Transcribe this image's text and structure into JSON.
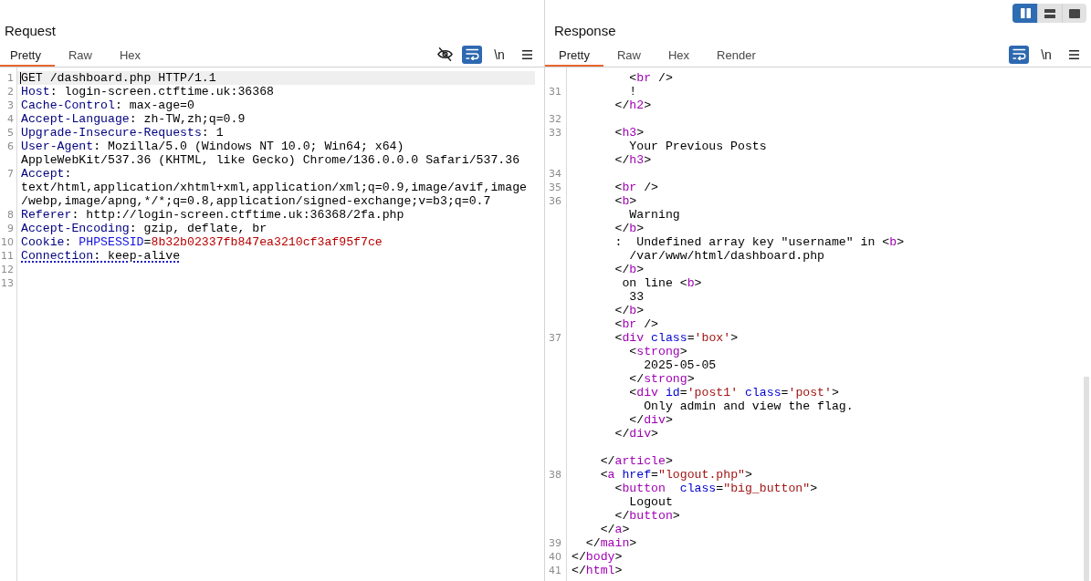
{
  "layout_toggle": [
    {
      "kind": "columns",
      "selected": true
    },
    {
      "kind": "rows",
      "selected": false
    },
    {
      "kind": "single",
      "selected": false
    }
  ],
  "request": {
    "title": "Request",
    "tabs": [
      {
        "label": "Pretty",
        "selected": true
      },
      {
        "label": "Raw",
        "selected": false
      },
      {
        "label": "Hex",
        "selected": false
      }
    ],
    "toolbar": [
      {
        "kind": "hide",
        "on": false
      },
      {
        "kind": "wrap",
        "on": true
      },
      {
        "kind": "newlines",
        "label": "\\n",
        "on": false
      },
      {
        "kind": "menu",
        "on": false
      }
    ],
    "lines": [
      {
        "number": "1",
        "current": true,
        "underlined": false,
        "rows": [
          {
            "kind": "code",
            "segments": [
              {
                "kind": "plain",
                "text": "GET /dashboard.php HTTP/1.1"
              }
            ]
          }
        ]
      },
      {
        "number": "2",
        "current": false,
        "underlined": false,
        "rows": [
          {
            "kind": "code",
            "segments": [
              {
                "kind": "header",
                "text": "Host"
              },
              {
                "kind": "plain",
                "text": ": login-screen.ctftime.uk:36368"
              }
            ]
          }
        ]
      },
      {
        "number": "3",
        "current": false,
        "underlined": false,
        "rows": [
          {
            "kind": "code",
            "segments": [
              {
                "kind": "header",
                "text": "Cache-Control"
              },
              {
                "kind": "plain",
                "text": ": max-age=0"
              }
            ]
          }
        ]
      },
      {
        "number": "4",
        "current": false,
        "underlined": false,
        "rows": [
          {
            "kind": "code",
            "segments": [
              {
                "kind": "header",
                "text": "Accept-Language"
              },
              {
                "kind": "plain",
                "text": ": zh-TW,zh;q=0.9"
              }
            ]
          }
        ]
      },
      {
        "number": "5",
        "current": false,
        "underlined": false,
        "rows": [
          {
            "kind": "code",
            "segments": [
              {
                "kind": "header",
                "text": "Upgrade-Insecure-Requests"
              },
              {
                "kind": "plain",
                "text": ": 1"
              }
            ]
          }
        ]
      },
      {
        "number": "6",
        "current": false,
        "underlined": false,
        "rows": [
          {
            "kind": "code",
            "segments": [
              {
                "kind": "header",
                "text": "User-Agent"
              },
              {
                "kind": "plain",
                "text": ": Mozilla/5.0 (Windows NT 10.0; Win64; x64)"
              }
            ]
          },
          {
            "kind": "code",
            "segments": [
              {
                "kind": "plain",
                "text": "AppleWebKit/537.36 (KHTML, like Gecko) Chrome/136.0.0.0 Safari/537.36"
              }
            ]
          }
        ]
      },
      {
        "number": "7",
        "current": false,
        "underlined": false,
        "rows": [
          {
            "kind": "code",
            "segments": [
              {
                "kind": "header",
                "text": "Accept"
              },
              {
                "kind": "plain",
                "text": ":"
              }
            ]
          },
          {
            "kind": "code",
            "segments": [
              {
                "kind": "plain",
                "text": "text/html,application/xhtml+xml,application/xml;q=0.9,image/avif,image"
              }
            ]
          },
          {
            "kind": "code",
            "segments": [
              {
                "kind": "plain",
                "text": "/webp,image/apng,*/*;q=0.8,application/signed-exchange;v=b3;q=0.7"
              }
            ]
          }
        ]
      },
      {
        "number": "8",
        "current": false,
        "underlined": false,
        "rows": [
          {
            "kind": "code",
            "segments": [
              {
                "kind": "header",
                "text": "Referer"
              },
              {
                "kind": "plain",
                "text": ": http://login-screen.ctftime.uk:36368/2fa.php"
              }
            ]
          }
        ]
      },
      {
        "number": "9",
        "current": false,
        "underlined": false,
        "rows": [
          {
            "kind": "code",
            "segments": [
              {
                "kind": "header",
                "text": "Accept-Encoding"
              },
              {
                "kind": "plain",
                "text": ": gzip, deflate, br"
              }
            ]
          }
        ]
      },
      {
        "number": "10",
        "current": false,
        "underlined": false,
        "rows": [
          {
            "kind": "code",
            "segments": [
              {
                "kind": "header",
                "text": "Cookie"
              },
              {
                "kind": "plain",
                "text": ": "
              },
              {
                "kind": "cookie_name",
                "text": "PHPSESSID"
              },
              {
                "kind": "plain",
                "text": "="
              },
              {
                "kind": "cookie_value",
                "text": "8b32b02337fb847ea3210cf3af95f7ce"
              }
            ]
          }
        ]
      },
      {
        "number": "11",
        "current": false,
        "underlined": true,
        "rows": [
          {
            "kind": "code",
            "segments": [
              {
                "kind": "header",
                "text": "Connection"
              },
              {
                "kind": "plain",
                "text": ": keep-alive"
              }
            ]
          }
        ]
      },
      {
        "number": "12",
        "current": false,
        "rows": [
          {
            "kind": "blank"
          }
        ]
      },
      {
        "number": "13",
        "current": false,
        "rows": [
          {
            "kind": "blank"
          }
        ]
      }
    ]
  },
  "response": {
    "title": "Response",
    "tabs": [
      {
        "label": "Pretty",
        "selected": true
      },
      {
        "label": "Raw",
        "selected": false
      },
      {
        "label": "Hex",
        "selected": false
      },
      {
        "label": "Render",
        "selected": false
      }
    ],
    "toolbar": [
      {
        "kind": "wrap",
        "on": true
      },
      {
        "kind": "newlines",
        "label": "\\n",
        "on": false
      },
      {
        "kind": "menu",
        "on": false
      }
    ],
    "lines": [
      {
        "rows": [
          {
            "kind": "code",
            "segments": [
              {
                "kind": "plain",
                "text": "        <"
              },
              {
                "kind": "tag",
                "text": "br"
              },
              {
                "kind": "plain",
                "text": " />"
              }
            ]
          }
        ]
      },
      {
        "number": "31",
        "rows": [
          {
            "kind": "code",
            "segments": [
              {
                "kind": "plain",
                "text": "        !"
              }
            ]
          },
          {
            "kind": "code",
            "segments": [
              {
                "kind": "plain",
                "text": "      </"
              },
              {
                "kind": "tag",
                "text": "h2"
              },
              {
                "kind": "plain",
                "text": ">"
              }
            ]
          }
        ]
      },
      {
        "number": "32",
        "rows": [
          {
            "kind": "blank"
          }
        ]
      },
      {
        "number": "33",
        "rows": [
          {
            "kind": "code",
            "segments": [
              {
                "kind": "plain",
                "text": "      <"
              },
              {
                "kind": "tag",
                "text": "h3"
              },
              {
                "kind": "plain",
                "text": ">"
              }
            ]
          },
          {
            "kind": "code",
            "segments": [
              {
                "kind": "plain",
                "text": "        Your Previous Posts"
              }
            ]
          },
          {
            "kind": "code",
            "segments": [
              {
                "kind": "plain",
                "text": "      </"
              },
              {
                "kind": "tag",
                "text": "h3"
              },
              {
                "kind": "plain",
                "text": ">"
              }
            ]
          }
        ]
      },
      {
        "number": "34",
        "rows": [
          {
            "kind": "blank"
          }
        ]
      },
      {
        "number": "35",
        "rows": [
          {
            "kind": "code",
            "segments": [
              {
                "kind": "plain",
                "text": "      <"
              },
              {
                "kind": "tag",
                "text": "br"
              },
              {
                "kind": "plain",
                "text": " />"
              }
            ]
          }
        ]
      },
      {
        "number": "36",
        "rows": [
          {
            "kind": "code",
            "segments": [
              {
                "kind": "plain",
                "text": "      <"
              },
              {
                "kind": "tag",
                "text": "b"
              },
              {
                "kind": "plain",
                "text": ">"
              }
            ]
          },
          {
            "kind": "code",
            "segments": [
              {
                "kind": "plain",
                "text": "        Warning"
              }
            ]
          },
          {
            "kind": "code",
            "segments": [
              {
                "kind": "plain",
                "text": "      </"
              },
              {
                "kind": "tag",
                "text": "b"
              },
              {
                "kind": "plain",
                "text": ">"
              }
            ]
          },
          {
            "kind": "code",
            "segments": [
              {
                "kind": "plain",
                "text": "      :  Undefined array key \"username\" in <"
              },
              {
                "kind": "tag",
                "text": "b"
              },
              {
                "kind": "plain",
                "text": ">"
              }
            ]
          },
          {
            "kind": "code",
            "segments": [
              {
                "kind": "plain",
                "text": "        /var/www/html/dashboard.php"
              }
            ]
          },
          {
            "kind": "code",
            "segments": [
              {
                "kind": "plain",
                "text": "      </"
              },
              {
                "kind": "tag",
                "text": "b"
              },
              {
                "kind": "plain",
                "text": ">"
              }
            ]
          },
          {
            "kind": "code",
            "segments": [
              {
                "kind": "plain",
                "text": "       on line <"
              },
              {
                "kind": "tag",
                "text": "b"
              },
              {
                "kind": "plain",
                "text": ">"
              }
            ]
          },
          {
            "kind": "code",
            "segments": [
              {
                "kind": "plain",
                "text": "        33"
              }
            ]
          },
          {
            "kind": "code",
            "segments": [
              {
                "kind": "plain",
                "text": "      </"
              },
              {
                "kind": "tag",
                "text": "b"
              },
              {
                "kind": "plain",
                "text": ">"
              }
            ]
          },
          {
            "kind": "code",
            "segments": [
              {
                "kind": "plain",
                "text": "      <"
              },
              {
                "kind": "tag",
                "text": "br"
              },
              {
                "kind": "plain",
                "text": " />"
              }
            ]
          }
        ]
      },
      {
        "number": "37",
        "rows": [
          {
            "kind": "code",
            "segments": [
              {
                "kind": "plain",
                "text": "      <"
              },
              {
                "kind": "tag",
                "text": "div"
              },
              {
                "kind": "attr",
                "text": " class"
              },
              {
                "kind": "plain",
                "text": "="
              },
              {
                "kind": "value",
                "text": "'box'"
              },
              {
                "kind": "plain",
                "text": ">"
              }
            ]
          },
          {
            "kind": "code",
            "segments": [
              {
                "kind": "plain",
                "text": "        <"
              },
              {
                "kind": "tag",
                "text": "strong"
              },
              {
                "kind": "plain",
                "text": ">"
              }
            ]
          },
          {
            "kind": "code",
            "segments": [
              {
                "kind": "plain",
                "text": "          2025-05-05"
              }
            ]
          },
          {
            "kind": "code",
            "segments": [
              {
                "kind": "plain",
                "text": "        </"
              },
              {
                "kind": "tag",
                "text": "strong"
              },
              {
                "kind": "plain",
                "text": ">"
              }
            ]
          },
          {
            "kind": "code",
            "segments": [
              {
                "kind": "plain",
                "text": "        <"
              },
              {
                "kind": "tag",
                "text": "div"
              },
              {
                "kind": "attr",
                "text": " id"
              },
              {
                "kind": "plain",
                "text": "="
              },
              {
                "kind": "value",
                "text": "'post1'"
              },
              {
                "kind": "attr",
                "text": " class"
              },
              {
                "kind": "plain",
                "text": "="
              },
              {
                "kind": "value",
                "text": "'post'"
              },
              {
                "kind": "plain",
                "text": ">"
              }
            ]
          },
          {
            "kind": "code",
            "segments": [
              {
                "kind": "plain",
                "text": "          Only admin and view the flag."
              }
            ]
          },
          {
            "kind": "code",
            "segments": [
              {
                "kind": "plain",
                "text": "        </"
              },
              {
                "kind": "tag",
                "text": "div"
              },
              {
                "kind": "plain",
                "text": ">"
              }
            ]
          },
          {
            "kind": "code",
            "segments": [
              {
                "kind": "plain",
                "text": "      </"
              },
              {
                "kind": "tag",
                "text": "div"
              },
              {
                "kind": "plain",
                "text": ">"
              }
            ]
          },
          {
            "kind": "blank"
          },
          {
            "kind": "code",
            "segments": [
              {
                "kind": "plain",
                "text": "    </"
              },
              {
                "kind": "tag",
                "text": "article"
              },
              {
                "kind": "plain",
                "text": ">"
              }
            ]
          }
        ]
      },
      {
        "number": "38",
        "rows": [
          {
            "kind": "code",
            "segments": [
              {
                "kind": "plain",
                "text": "    <"
              },
              {
                "kind": "tag",
                "text": "a"
              },
              {
                "kind": "attr",
                "text": " href"
              },
              {
                "kind": "plain",
                "text": "="
              },
              {
                "kind": "value",
                "text": "\"logout.php\""
              },
              {
                "kind": "plain",
                "text": ">"
              }
            ]
          },
          {
            "kind": "code",
            "segments": [
              {
                "kind": "plain",
                "text": "      <"
              },
              {
                "kind": "tag",
                "text": "button"
              },
              {
                "kind": "attr",
                "text": "  class"
              },
              {
                "kind": "plain",
                "text": "="
              },
              {
                "kind": "value",
                "text": "\"big_button\""
              },
              {
                "kind": "plain",
                "text": ">"
              }
            ]
          },
          {
            "kind": "code",
            "segments": [
              {
                "kind": "plain",
                "text": "        Logout"
              }
            ]
          },
          {
            "kind": "code",
            "segments": [
              {
                "kind": "plain",
                "text": "      </"
              },
              {
                "kind": "tag",
                "text": "button"
              },
              {
                "kind": "plain",
                "text": ">"
              }
            ]
          },
          {
            "kind": "code",
            "segments": [
              {
                "kind": "plain",
                "text": "    </"
              },
              {
                "kind": "tag",
                "text": "a"
              },
              {
                "kind": "plain",
                "text": ">"
              }
            ]
          }
        ]
      },
      {
        "number": "39",
        "rows": [
          {
            "kind": "code",
            "segments": [
              {
                "kind": "plain",
                "text": "  </"
              },
              {
                "kind": "tag",
                "text": "main"
              },
              {
                "kind": "plain",
                "text": ">"
              }
            ]
          }
        ]
      },
      {
        "number": "40",
        "rows": [
          {
            "kind": "code",
            "segments": [
              {
                "kind": "plain",
                "text": "</"
              },
              {
                "kind": "tag",
                "text": "body"
              },
              {
                "kind": "plain",
                "text": ">"
              }
            ]
          }
        ]
      },
      {
        "number": "41",
        "rows": [
          {
            "kind": "code",
            "segments": [
              {
                "kind": "plain",
                "text": "</"
              },
              {
                "kind": "tag",
                "text": "html"
              },
              {
                "kind": "plain",
                "text": ">"
              }
            ]
          }
        ]
      }
    ]
  }
}
